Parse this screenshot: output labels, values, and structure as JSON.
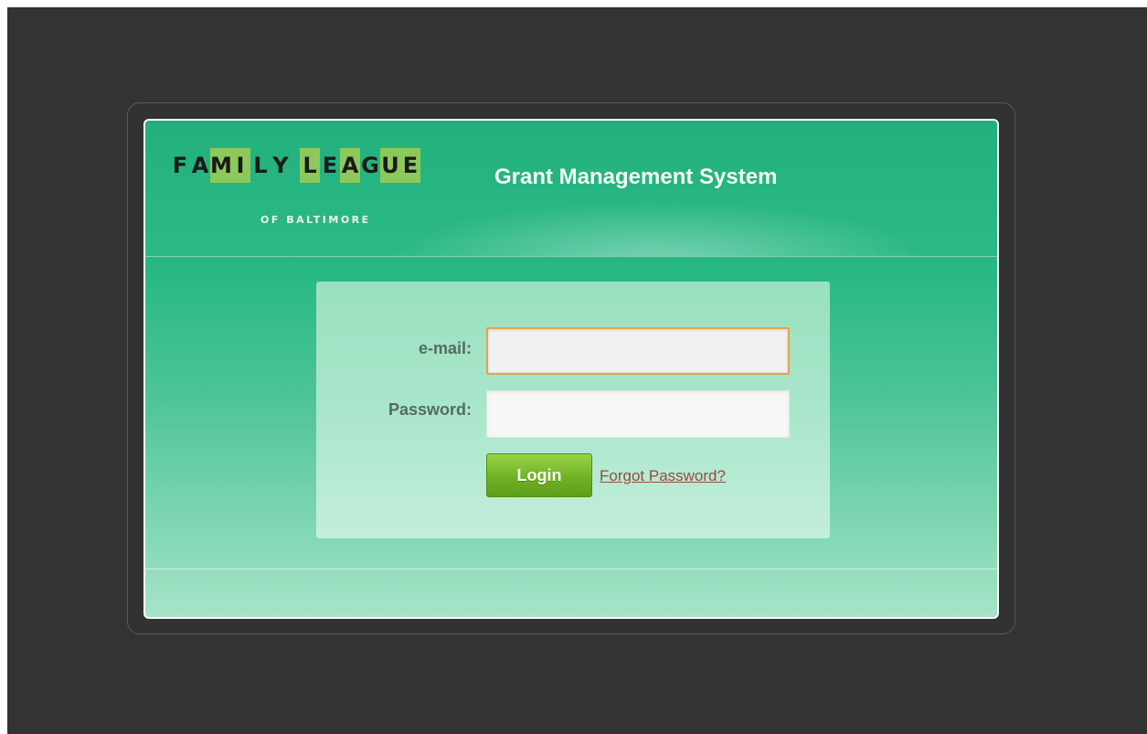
{
  "header": {
    "logo_text": "FAMILY LEAGUE",
    "logo_subtitle": "OF BALTIMORE",
    "app_title": "Grant Management System"
  },
  "login_form": {
    "email_label": "e-mail:",
    "email_value": "",
    "password_label": "Password:",
    "password_value": "",
    "login_button": "Login",
    "forgot_link": "Forgot Password?"
  },
  "colors": {
    "background": "#333333",
    "header_green": "#22b07c",
    "logo_highlight": "#8cc95a",
    "button_green": "#6fb324",
    "focus_border": "#e3a34a",
    "link_color": "#9a4a3a"
  }
}
